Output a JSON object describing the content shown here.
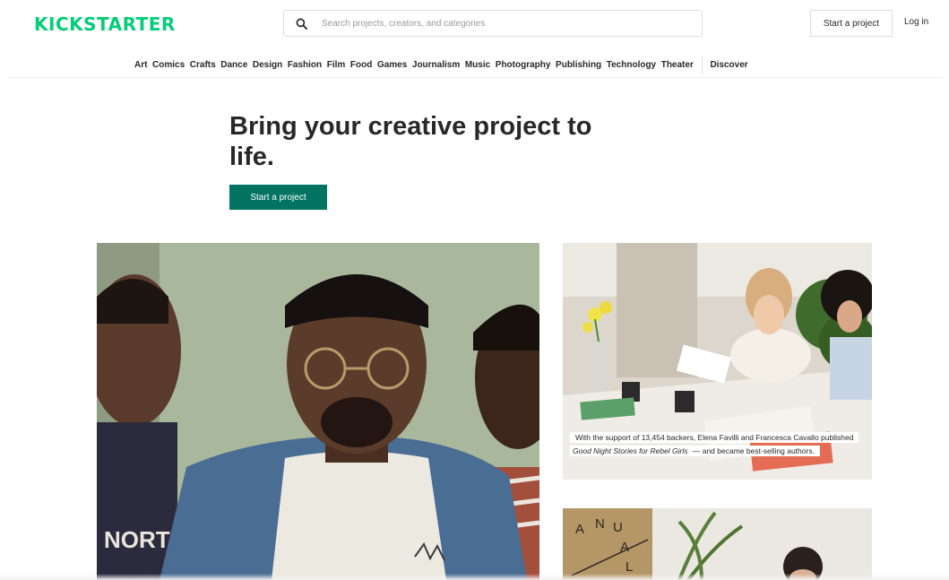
{
  "header": {
    "logo_text": "KICKSTARTER",
    "search_placeholder": "Search projects, creators, and categories",
    "start_project_label": "Start a project",
    "login_label": "Log in"
  },
  "categories": [
    "Art",
    "Comics",
    "Crafts",
    "Dance",
    "Design",
    "Fashion",
    "Film",
    "Food",
    "Games",
    "Journalism",
    "Music",
    "Photography",
    "Publishing",
    "Technology",
    "Theater"
  ],
  "discover_label": "Discover",
  "hero": {
    "title": "Bring your creative project to life.",
    "cta_label": "Start a project"
  },
  "featured": {
    "caption_before": "With the support of 13,454 backers, Elena Favilli and Francesca Cavallo published ",
    "caption_title": "Good Night Stories for Rebel Girls",
    "caption_after": " — and became best-selling authors."
  },
  "colors": {
    "brand_green": "#05ce78",
    "cta_green": "#037362",
    "text": "#282828"
  },
  "icons": {
    "search": "search-icon"
  }
}
